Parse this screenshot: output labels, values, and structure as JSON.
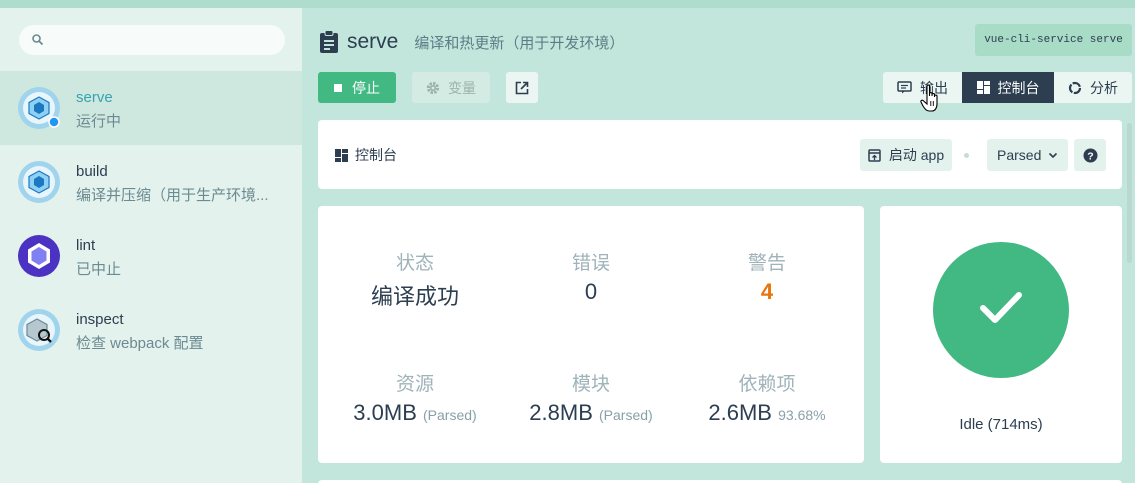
{
  "sidebar": {
    "search": {
      "placeholder": ""
    },
    "tasks": [
      {
        "name": "serve",
        "desc": "运行中",
        "icon": "webpack-cube-icon",
        "status": "running"
      },
      {
        "name": "build",
        "desc": "编译并压缩（用于生产环境...",
        "icon": "webpack-cube-icon"
      },
      {
        "name": "lint",
        "desc": "已中止",
        "icon": "eslint-hexagon-icon"
      },
      {
        "name": "inspect",
        "desc": "检查 webpack 配置",
        "icon": "webpack-inspect-icon"
      }
    ]
  },
  "header": {
    "name": "serve",
    "desc": "编译和热更新（用于开发环境）",
    "command": "vue-cli-service serve"
  },
  "toolbar": {
    "stop": "停止",
    "variables": "变量",
    "views": {
      "output": "输出",
      "console": "控制台",
      "analyze": "分析"
    }
  },
  "dashboard": {
    "title": "控制台",
    "start_app": "启动 app",
    "mode": "Parsed",
    "help": "?"
  },
  "stats": {
    "status": {
      "label": "状态",
      "value": "编译成功"
    },
    "errors": {
      "label": "错误",
      "value": "0"
    },
    "warnings": {
      "label": "警告",
      "value": "4"
    },
    "assets": {
      "label": "资源",
      "value": "3.0MB",
      "suffix": "(Parsed)"
    },
    "modules": {
      "label": "模块",
      "value": "2.8MB",
      "suffix": "(Parsed)"
    },
    "deps": {
      "label": "依赖项",
      "value": "2.6MB",
      "suffix": "93.68%"
    }
  },
  "build_status": {
    "text": "Idle (714ms)"
  },
  "colors": {
    "accent": "#42b883",
    "dark": "#2c3e50",
    "warning": "#e8750b",
    "link": "#36a3b2"
  }
}
